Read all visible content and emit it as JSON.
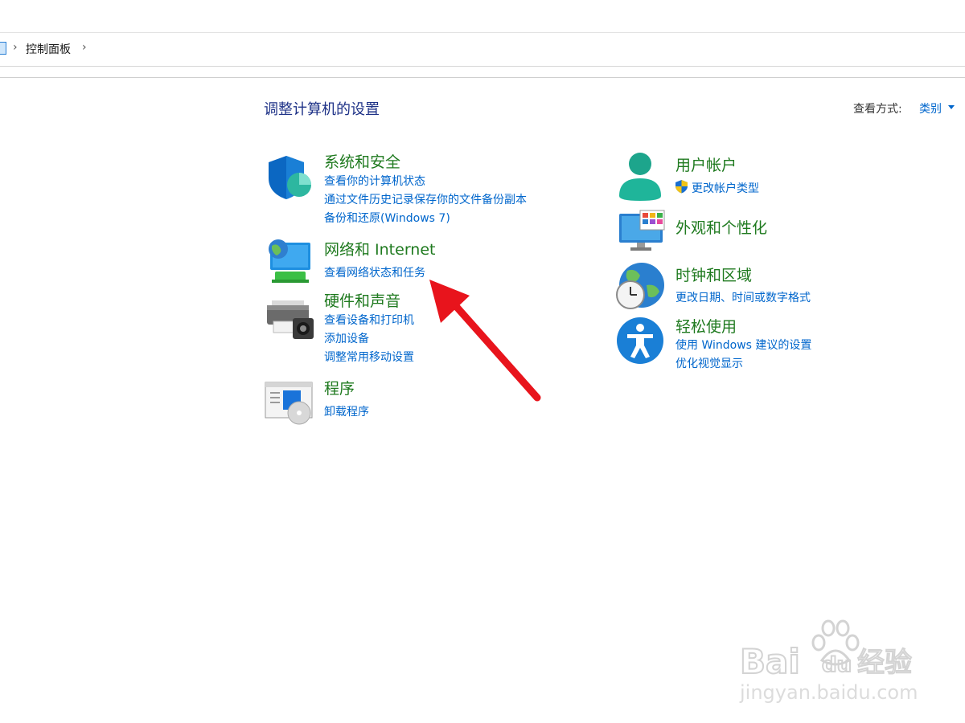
{
  "breadcrumb": {
    "current": "控制面板"
  },
  "page_title": "调整计算机的设置",
  "view_by": {
    "label": "查看方式:",
    "value": "类别"
  },
  "categories": [
    {
      "title": "系统和安全",
      "links": [
        "查看你的计算机状态",
        "通过文件历史记录保存你的文件备份副本",
        "备份和还原(Windows 7)"
      ],
      "icon": "shield-icon"
    },
    {
      "title": "网络和 Internet",
      "links": [
        "查看网络状态和任务"
      ],
      "icon": "network-icon"
    },
    {
      "title": "硬件和声音",
      "links": [
        "查看设备和打印机",
        "添加设备",
        "调整常用移动设置"
      ],
      "icon": "printer-icon"
    },
    {
      "title": "程序",
      "links": [
        "卸载程序"
      ],
      "icon": "programs-icon"
    },
    {
      "title": "用户帐户",
      "links": [
        "更改帐户类型"
      ],
      "icon": "user-icon"
    },
    {
      "title": "外观和个性化",
      "links": [],
      "icon": "monitor-icon"
    },
    {
      "title": "时钟和区域",
      "links": [
        "更改日期、时间或数字格式"
      ],
      "icon": "clock-globe-icon"
    },
    {
      "title": "轻松使用",
      "links": [
        "使用 Windows 建议的设置",
        "优化视觉显示"
      ],
      "icon": "accessibility-icon"
    }
  ],
  "watermark": {
    "brand": "Bai du 经验",
    "url": "jingyan.baidu.com"
  },
  "colors": {
    "category_title": "#1f7a1f",
    "link": "#0066cc",
    "page_title": "#1e3287",
    "annotation_arrow": "#e8141c"
  }
}
